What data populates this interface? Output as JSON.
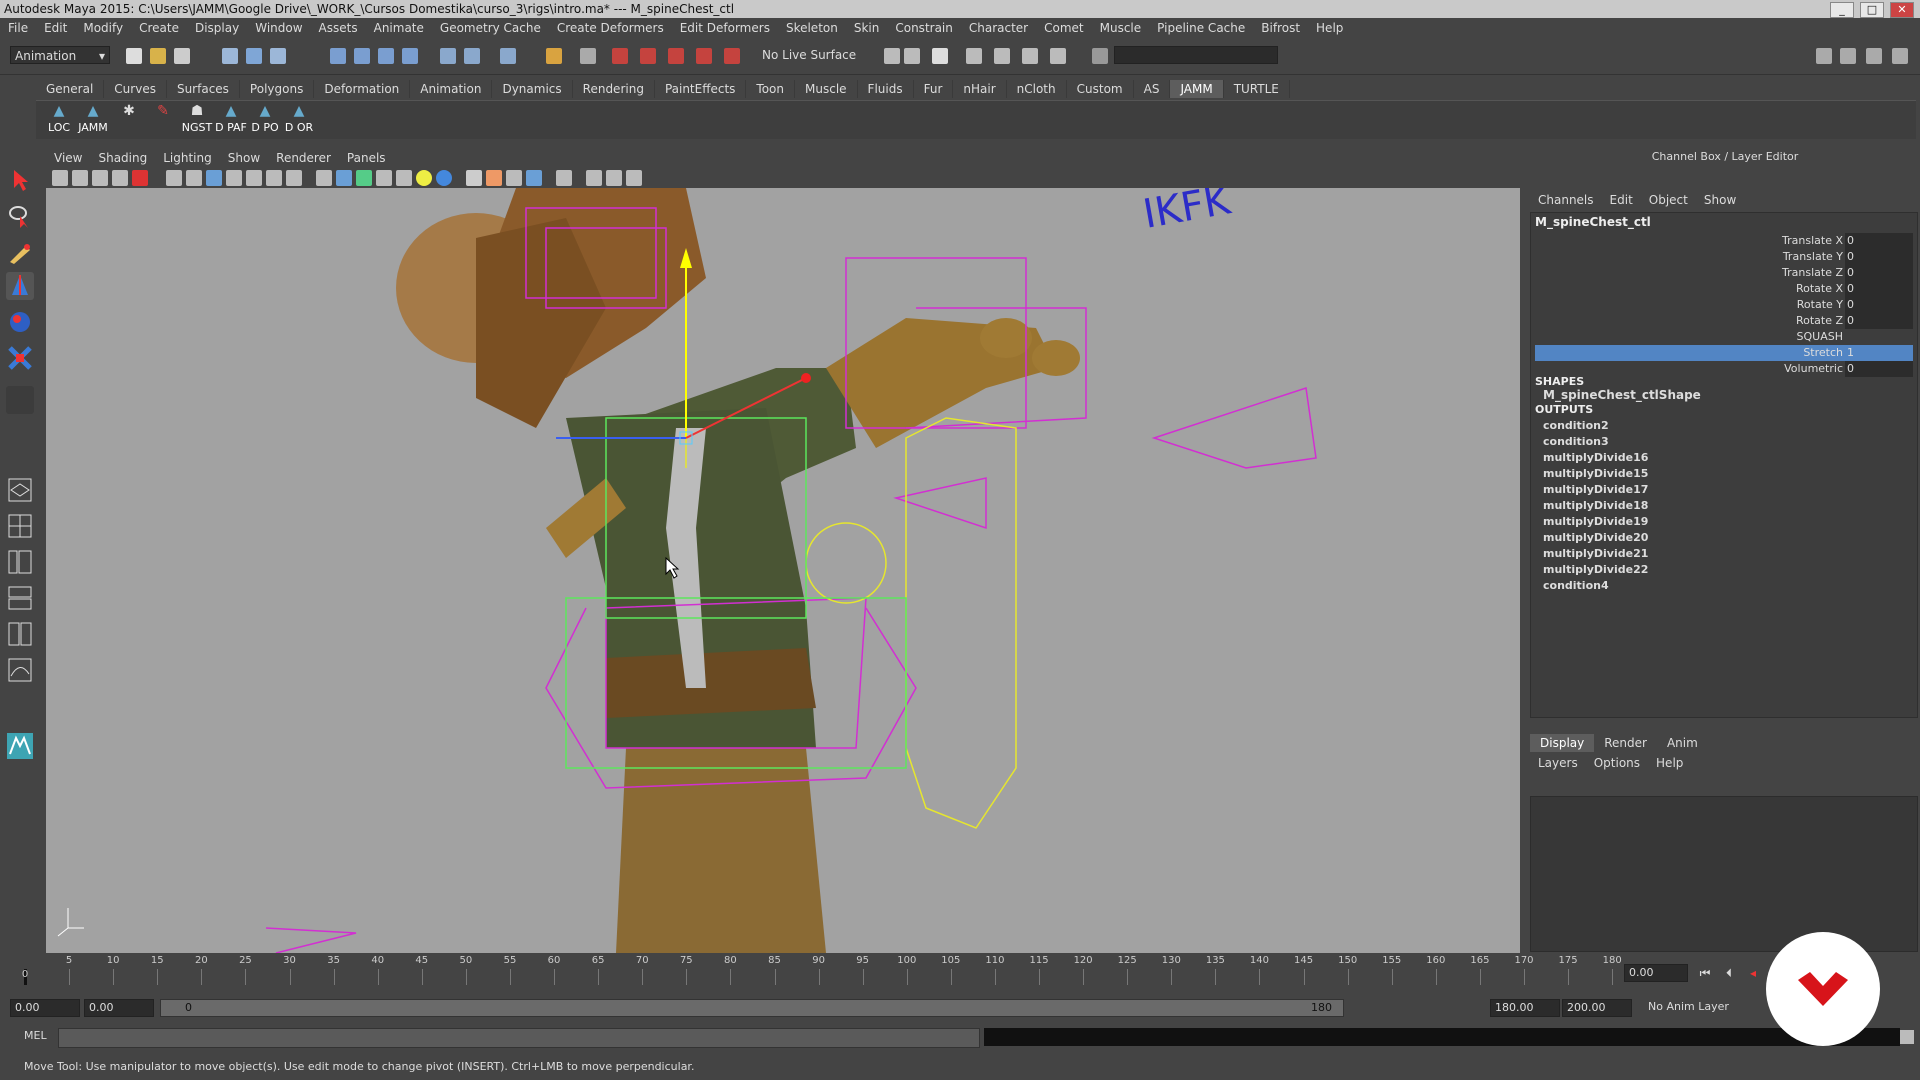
{
  "window": {
    "title": "Autodesk Maya 2015: C:\\Users\\JAMM\\Google Drive\\_WORK_\\Cursos Domestika\\curso_3\\rigs\\intro.ma*  ---  M_spineChest_ctl"
  },
  "menubar": [
    "File",
    "Edit",
    "Modify",
    "Create",
    "Display",
    "Window",
    "Assets",
    "Animate",
    "Geometry Cache",
    "Create Deformers",
    "Edit Deformers",
    "Skeleton",
    "Skin",
    "Constrain",
    "Character",
    "Comet",
    "Muscle",
    "Pipeline Cache",
    "Bifrost",
    "Help"
  ],
  "status": {
    "mode": "Animation",
    "live_surface": "No Live Surface"
  },
  "shelf": {
    "tabs": [
      "General",
      "Curves",
      "Surfaces",
      "Polygons",
      "Deformation",
      "Animation",
      "Dynamics",
      "Rendering",
      "PaintEffects",
      "Toon",
      "Muscle",
      "Fluids",
      "Fur",
      "nHair",
      "nCloth",
      "Custom",
      "AS",
      "JAMM",
      "TURTLE"
    ],
    "active_tab": "JAMM",
    "items": [
      "LOC",
      "JAMM",
      "",
      "",
      "NGST",
      "D PAF",
      "D PO",
      "D OR"
    ]
  },
  "panel": {
    "menu": [
      "View",
      "Shading",
      "Lighting",
      "Show",
      "Renderer",
      "Panels"
    ]
  },
  "viewport": {
    "overlay_text": "IKFK"
  },
  "channel_box": {
    "title": "Channel Box / Layer Editor",
    "menu": [
      "Channels",
      "Edit",
      "Object",
      "Show"
    ],
    "node": "M_spineChest_ctl",
    "attributes": [
      {
        "name": "Translate X",
        "value": "0"
      },
      {
        "name": "Translate Y",
        "value": "0"
      },
      {
        "name": "Translate Z",
        "value": "0"
      },
      {
        "name": "Rotate X",
        "value": "0"
      },
      {
        "name": "Rotate Y",
        "value": "0"
      },
      {
        "name": "Rotate Z",
        "value": "0"
      },
      {
        "name": "SQUASH",
        "value": ""
      },
      {
        "name": "Stretch",
        "value": "1"
      },
      {
        "name": "Volumetric",
        "value": "0"
      }
    ],
    "selected_attribute": "Stretch",
    "shapes_header": "SHAPES",
    "shape": "M_spineChest_ctlShape",
    "outputs_header": "OUTPUTS",
    "outputs": [
      "condition2",
      "condition3",
      "multiplyDivide16",
      "multiplyDivide15",
      "multiplyDivide17",
      "multiplyDivide18",
      "multiplyDivide19",
      "multiplyDivide20",
      "multiplyDivide21",
      "multiplyDivide22",
      "condition4"
    ]
  },
  "layer_editor": {
    "tabs": [
      "Display",
      "Render",
      "Anim"
    ],
    "active_tab": "Display",
    "menu": [
      "Layers",
      "Options",
      "Help"
    ]
  },
  "timeline": {
    "ticks": [
      "5",
      "10",
      "15",
      "20",
      "25",
      "30",
      "35",
      "40",
      "45",
      "50",
      "55",
      "60",
      "65",
      "70",
      "75",
      "80",
      "85",
      "90",
      "95",
      "100",
      "105",
      "110",
      "115",
      "120",
      "125",
      "130",
      "135",
      "140",
      "145",
      "150",
      "155",
      "160",
      "165",
      "170",
      "175",
      "180"
    ],
    "current_frame_label": "0",
    "current_time": "0.00"
  },
  "range": {
    "start": "0.00",
    "playback_start": "0.00",
    "range_start_label": "0",
    "range_end_label": "180",
    "playback_end": "180.00",
    "end": "200.00",
    "anim_layer": "No Anim Layer"
  },
  "command_line": {
    "label": "MEL"
  },
  "help_line": "Move Tool: Use manipulator to move object(s). Use edit mode to change pivot (INSERT).  Ctrl+LMB to move perpendicular.",
  "colors": {
    "accent": "#5285c4",
    "viewport_bg": "#a2a2a2",
    "logo_red": "#d7141a",
    "wire_magenta": "#d22fd2",
    "wire_yellow": "#e6e62e"
  }
}
